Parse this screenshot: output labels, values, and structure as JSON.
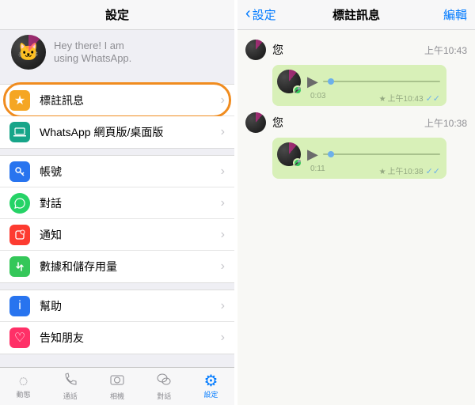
{
  "colors": {
    "starred": "#f5a623",
    "web": "#17a589",
    "account": "#2874ef",
    "chats": "#25d366",
    "notifications": "#fd3b30",
    "data": "#34c759",
    "help": "#2874ef",
    "tell": "#ff3067",
    "accent": "#007aff"
  },
  "left": {
    "title": "設定",
    "status": "Hey there! I am\nusing WhatsApp.",
    "rows": {
      "starred": "標註訊息",
      "web": "WhatsApp 網頁版/桌面版",
      "account": "帳號",
      "chats": "對話",
      "notifications": "通知",
      "data": "數據和儲存用量",
      "help": "幫助",
      "tell": "告知朋友"
    },
    "tabs": {
      "status": "動態",
      "calls": "通話",
      "camera": "相機",
      "chats": "對話",
      "settings": "設定"
    }
  },
  "right": {
    "back": "設定",
    "title": "標註訊息",
    "edit": "編輯",
    "messages": [
      {
        "sender": "您",
        "time": "上午10:43",
        "duration": "0:03",
        "stamp": "上午10:43"
      },
      {
        "sender": "您",
        "time": "上午10:38",
        "duration": "0:11",
        "stamp": "上午10:38"
      }
    ]
  }
}
